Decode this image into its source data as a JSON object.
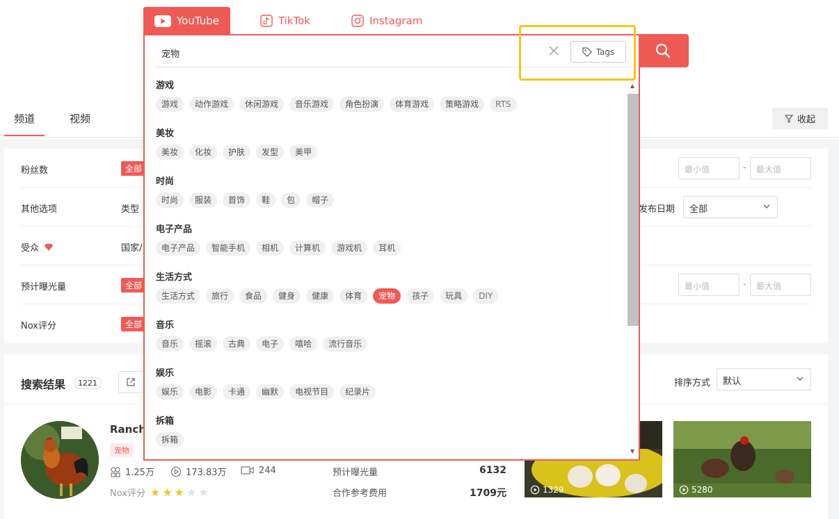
{
  "platforms": [
    {
      "label": "YouTube",
      "icon": "youtube-icon",
      "active": true
    },
    {
      "label": "TikTok",
      "icon": "tiktok-icon",
      "active": false
    },
    {
      "label": "Instagram",
      "icon": "instagram-icon",
      "active": false
    }
  ],
  "search": {
    "value": "宠物",
    "tags_label": "Tags"
  },
  "categories": [
    {
      "title": "游戏",
      "tags": [
        "游戏",
        "动作游戏",
        "休闲游戏",
        "音乐游戏",
        "角色扮演",
        "体育游戏",
        "策略游戏",
        "RTS"
      ]
    },
    {
      "title": "美妆",
      "tags": [
        "美妆",
        "化妆",
        "护肤",
        "发型",
        "美甲"
      ]
    },
    {
      "title": "时尚",
      "tags": [
        "时尚",
        "服装",
        "首饰",
        "鞋",
        "包",
        "帽子"
      ]
    },
    {
      "title": "电子产品",
      "tags": [
        "电子产品",
        "智能手机",
        "相机",
        "计算机",
        "游戏机",
        "耳机"
      ]
    },
    {
      "title": "生活方式",
      "tags": [
        "生活方式",
        "旅行",
        "食品",
        "健身",
        "健康",
        "体育",
        "宠物",
        "孩子",
        "玩具",
        "DIY"
      ]
    },
    {
      "title": "音乐",
      "tags": [
        "音乐",
        "摇滚",
        "古典",
        "电子",
        "嘻哈",
        "流行音乐"
      ]
    },
    {
      "title": "娱乐",
      "tags": [
        "娱乐",
        "电影",
        "卡通",
        "幽默",
        "电视节目",
        "纪录片"
      ]
    },
    {
      "title": "拆箱",
      "tags": [
        "拆箱"
      ]
    }
  ],
  "selected_tag": "宠物",
  "main_tabs": [
    "频道",
    "视频"
  ],
  "collapse_label": "收起",
  "filters": {
    "fans_label": "粉丝数",
    "other_label": "其他选项",
    "audience_label": "受众",
    "exposure_label": "预计曝光量",
    "nox_label": "Nox评分",
    "all_label": "全部",
    "type_label": "类型",
    "country_label": "国家/",
    "publish_date_label": "发布日期",
    "publish_date_value": "全部",
    "min_placeholder": "最小值",
    "max_placeholder": "最大值",
    "dash": "-"
  },
  "results": {
    "title": "搜索结果",
    "count": "1221",
    "sort_label": "排序方式",
    "sort_value": "默认"
  },
  "channel": {
    "name": "Rancho",
    "tag": "宠物",
    "subscribers": "1.25万",
    "views": "173.83万",
    "videos": "244",
    "nox_label": "Nox评分",
    "rating": 3,
    "rating_max": 5,
    "exposure_label": "预计曝光量",
    "exposure_value": "6132",
    "cost_label": "合作参考费用",
    "cost_value": "1709元"
  },
  "thumbnails": [
    {
      "views": "1329"
    },
    {
      "views": "5280"
    }
  ],
  "colors": {
    "accent": "#f05a55",
    "highlight": "#f5c518",
    "star_on": "#f7c51e",
    "star_off": "#e0e0e0"
  }
}
